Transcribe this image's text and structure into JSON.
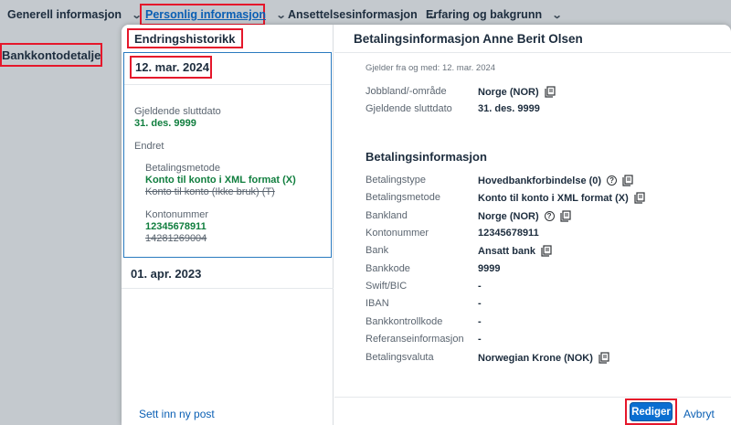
{
  "nav": {
    "items": [
      {
        "label": "Generell informasjon"
      },
      {
        "label": "Personlig informasjon"
      },
      {
        "label": "Ansettelsesinformasjon"
      },
      {
        "label": "Erfaring og bakgrunn"
      }
    ]
  },
  "background": {
    "heading": "Bankkontodetaljer"
  },
  "history": {
    "title": "Endringshistorikk",
    "items": [
      {
        "date": "12. mar. 2024",
        "end_label": "Gjeldende sluttdato",
        "end_value": "31. des. 9999",
        "changed_label": "Endret",
        "changes": [
          {
            "label": "Betalingsmetode",
            "new": "Konto til konto i XML format (X)",
            "old": "Konto til konto (Ikke bruk) (T)"
          },
          {
            "label": "Kontonummer",
            "new": "12345678911",
            "old": "14281269004"
          }
        ]
      },
      {
        "date": "01. apr. 2023"
      }
    ],
    "new_post": "Sett inn ny post"
  },
  "details": {
    "title": "Betalingsinformasjon Anne Berit Olsen",
    "valid_from": "Gjelder fra og med: 12. mar. 2024",
    "fields_top": [
      {
        "label": "Jobbland/-område",
        "value": "Norge (NOR)"
      },
      {
        "label": "Gjeldende sluttdato",
        "value": "31. des. 9999"
      }
    ],
    "section_title": "Betalingsinformasjon",
    "fields": [
      {
        "label": "Betalingstype",
        "value": "Hovedbankforbindelse (0)"
      },
      {
        "label": "Betalingsmetode",
        "value": "Konto til konto i XML format (X)"
      },
      {
        "label": "Bankland",
        "value": "Norge (NOR)"
      },
      {
        "label": "Kontonummer",
        "value": "12345678911"
      },
      {
        "label": "Bank",
        "value": "Ansatt bank"
      },
      {
        "label": "Bankkode",
        "value": "9999"
      },
      {
        "label": "Swift/BIC",
        "value": "-"
      },
      {
        "label": "IBAN",
        "value": "-"
      },
      {
        "label": "Bankkontrollkode",
        "value": "-"
      },
      {
        "label": "Referanseinformasjon",
        "value": "-"
      },
      {
        "label": "Betalingsvaluta",
        "value": "Norwegian Krone (NOK)"
      }
    ]
  },
  "footer": {
    "edit_label": "Rediger",
    "cancel_label": "Avbryt"
  },
  "colors": {
    "accent": "#0a6ed1",
    "highlight_border": "#e5172b",
    "changed_green": "#107e3e",
    "overlay": "#c4c9ce"
  }
}
